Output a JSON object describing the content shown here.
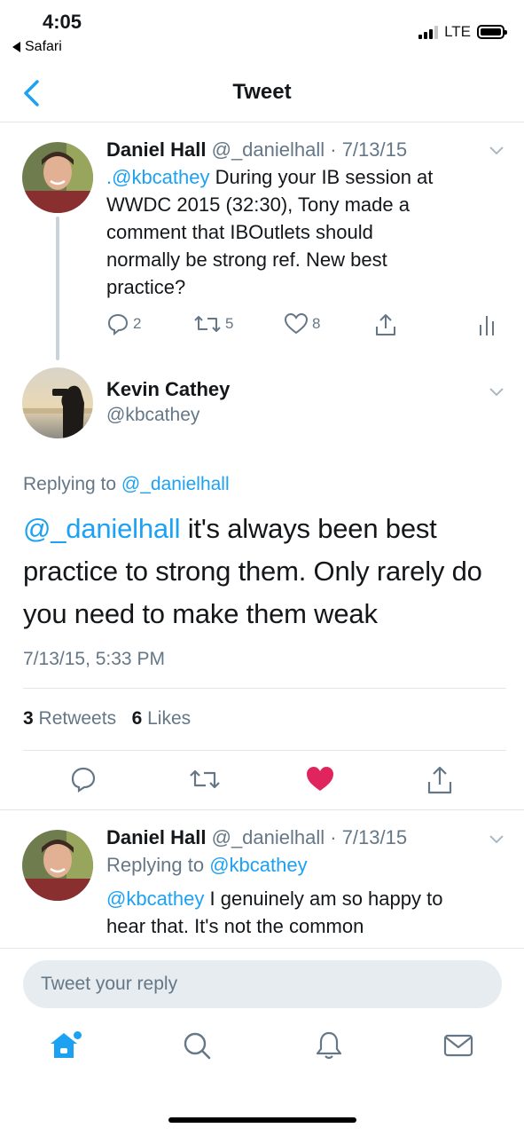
{
  "status_bar": {
    "time": "4:05",
    "back_app": "Safari",
    "network": "LTE"
  },
  "nav": {
    "title": "Tweet"
  },
  "colors": {
    "accent": "#1da1f2",
    "like": "#e0245e",
    "muted": "#657786"
  },
  "parent_tweet": {
    "name": "Daniel Hall",
    "meta": "@_danielhall · 7/13/15",
    "mention": ".@kbcathey",
    "lines": [
      " During your IB session at",
      "WWDC 2015 (32:30), Tony made a",
      "comment that IBOutlets should",
      "normally be strong ref. New best",
      "practice?"
    ],
    "replies": "2",
    "retweets": "5",
    "likes": "8"
  },
  "main_tweet": {
    "name": "Kevin Cathey",
    "handle": "@kbcathey",
    "replying_prefix": "Replying to ",
    "replying_to": "@_danielhall",
    "mention": "@_danielhall",
    "lines": [
      " it's always been best",
      "practice to strong them. Only rarely do",
      "you need to make them weak"
    ],
    "timestamp": "7/13/15, 5:33 PM",
    "retweet_count": "3",
    "retweet_label": "Retweets",
    "like_count": "6",
    "like_label": "Likes"
  },
  "reply_tweet": {
    "name": "Daniel Hall",
    "meta": "@_danielhall · 7/13/15",
    "replying_prefix": "Replying to ",
    "replying_to": "@kbcathey",
    "mention": "@kbcathey",
    "lines": [
      " I genuinely am so happy to",
      "hear that. It's not the common"
    ]
  },
  "compose": {
    "placeholder": "Tweet your reply"
  },
  "tabbar": {
    "icons": [
      "home-icon",
      "search-icon",
      "notifications-icon",
      "messages-icon"
    ]
  }
}
